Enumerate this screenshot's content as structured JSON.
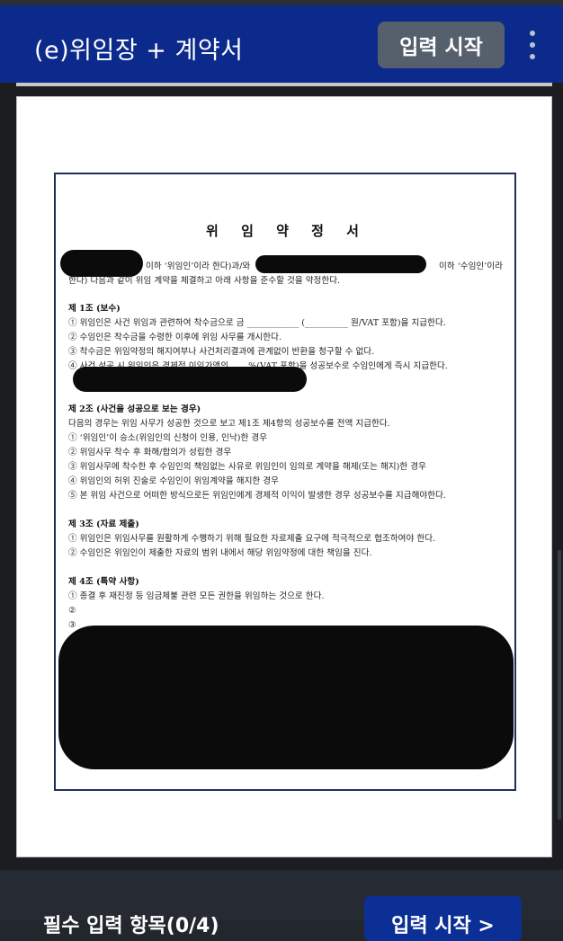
{
  "appbar": {
    "title": "(e)위임장 + 계약서",
    "start_label": "입력 시작"
  },
  "document": {
    "title": "위 임 약 정 서",
    "intro": [
      "이하 ‘위임인’이라 한다)과/와",
      "이하 ‘수임인’이라",
      "한다) 다음과 같이 위임 계약을 체결하고 아래 사항을 준수할 것을 약정한다."
    ],
    "article1": {
      "heading": "제 1조 (보수)",
      "items": [
        "① 위임인은 사건 위임과 관련하여 착수금으로 금 ____________ (__________ 원/VAT 포함)을 지급한다.",
        "② 수임인은 착수금을 수령한 이후에 위임 사무를 개시한다.",
        "③ 착수금은 위임약정의 해지여부나 사건처리결과에 관계없이 반환을 청구할 수 없다.",
        "④ 사건 성공 시 위임인은 경제적 이익가액의 ____%(VAT 포함)을 성공보수로 수임인에게 즉시 지급한다."
      ]
    },
    "article2": {
      "heading": "제 2조 (사건을 성공으로 보는 경우)",
      "items": [
        "다음의 경우는 위임 사무가 성공한 것으로 보고 제1조 제4항의 성공보수를 전액 지급한다.",
        "① ‘위임인’이 승소(위임인의 신청이 인용, 인낙)한 경우",
        "② 위임사무 착수 후 화해/합의가 성립한 경우",
        "③ 위임사무에 착수한 후 수임인의 책임없는 사유로 위임인이 임의로 계약을 해제(또는 해지)한 경우",
        "④ 위임인의 허위 진술로 수임인이 위임계약을 해지한 경우",
        "⑤ 본 위임 사건으로 어떠한 방식으로든 위임인에게 경제적 이익이 발생한 경우 성공보수를 지급해야한다."
      ]
    },
    "article3": {
      "heading": "제 3조 (자료 제출)",
      "items": [
        "① 위임인은 위임사무를 원활하게 수행하기 위해 필요한 자료제출 요구에 적극적으로 협조하여야 한다.",
        "② 수임인은 위임인이 제출한 자료의 범위 내에서 해당 위임약정에 대한 책임을 진다."
      ]
    },
    "article4": {
      "heading": "제 4조 (특약 사항)",
      "items": [
        "① 종결 후 재진정 등 임금체불 관련 모든 권한을 위임하는 것으로 한다.",
        "②",
        "③"
      ]
    }
  },
  "bottom": {
    "required_label": "필수 입력 항목(0/4)",
    "start_label": "입력 시작 >"
  }
}
